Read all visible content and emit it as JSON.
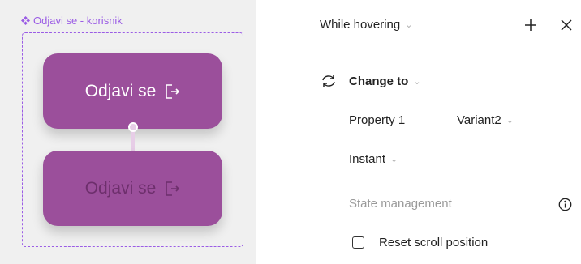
{
  "canvas": {
    "component_label": "Odjavi se - korisnik",
    "variant1_label": "Odjavi se",
    "variant2_label": "Odjavi se"
  },
  "panel": {
    "trigger_label": "While hovering",
    "action_label": "Change to",
    "property_name": "Property 1",
    "property_value": "Variant2",
    "animation_label": "Instant",
    "state_management_label": "State management",
    "reset_scroll_label": "Reset scroll position"
  },
  "colors": {
    "accent": "#9b5de5",
    "button_fill": "#9b4f9b"
  },
  "icons": [
    "component-diamond-icon",
    "logout-icon",
    "plus-icon",
    "close-icon",
    "swap-icon",
    "info-icon",
    "chevron-down-icon"
  ]
}
